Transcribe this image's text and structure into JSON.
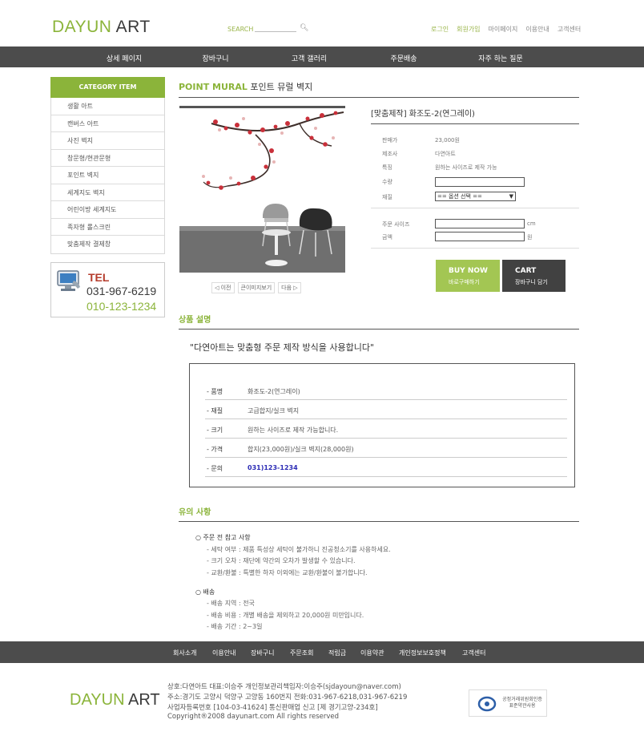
{
  "header": {
    "logo_a": "DAYUN",
    "logo_b": " ART",
    "search_label": "SEARCH",
    "top_links": [
      "로그인",
      "회원가입",
      "마이페이지",
      "이용안내",
      "고객센터"
    ]
  },
  "nav": [
    "상세 페이지",
    "장바구니",
    "고객 갤러리",
    "주문배송",
    "자주 하는 질문"
  ],
  "sidebar": {
    "category_title": "CATEGORY ITEM",
    "items": [
      "생활 아트",
      "캔버스 아트",
      "사진 벽지",
      "창문형/현관문형",
      "포인트 벽지",
      "세계지도 벽지",
      "어린이방 세계지도",
      "족자형 롤스크린",
      "맞춤제작 결제창"
    ],
    "tel_label": "TEL",
    "tel_1": "031-967-6219",
    "tel_2": "010-123-1234"
  },
  "product": {
    "section_en": "POINT MURAL",
    "section_ko": " 포인트 뮤럴 벽지",
    "name": "[맞춤제작] 화조도-2(연그레이)",
    "rows": {
      "price_label": "판매가",
      "price": "23,000원",
      "maker_label": "제조사",
      "maker": "다연아트",
      "feature_label": "특징",
      "feature": "원하는 사이즈로 제작 가능",
      "qty_label": "수량",
      "material_label": "재질",
      "material_select": "== 옵션 선택 ==",
      "size_label": "주문 사이즈",
      "size_unit": "cm",
      "amount_label": "금액",
      "amount_unit": "원"
    },
    "image_nav": {
      "prev": "◁ 이전",
      "zoom": "큰이미지보기",
      "next": "다음 ▷"
    },
    "buy_button": {
      "title": "BUY NOW",
      "sub": "바로구매하기"
    },
    "cart_button": {
      "title": "CART",
      "sub": "장바구니 담기"
    }
  },
  "description": {
    "title": "상품 설명",
    "quote": "\"다연아트는 맞춤형 주문 제작 방식을 사용합니다\"",
    "specs": [
      {
        "k": "- 품명",
        "v": "화조도-2(연그레이)"
      },
      {
        "k": "- 재질",
        "v": "고급합지/실크 벽지"
      },
      {
        "k": "- 크기",
        "v": "원하는 사이즈로 제작 가능합니다."
      },
      {
        "k": "- 가격",
        "v": "합지(23,000원)/실크 벽지(28,000원)"
      },
      {
        "k": "- 문의",
        "v": "031)123-1234"
      }
    ]
  },
  "notice": {
    "title": "유의 사항",
    "group1_title": "○ 주문 전 참고 사항",
    "group1": [
      "- 세탁 여부 : 제품 특성상 세탁이 불가하니 진공청소기를 사용하세요.",
      "- 크기 오차 : 재단에 약간의 오차가 발생할 수 있습니다.",
      "- 교환/환불 : 특별한 하자 이외에는 교환/환불이 불가합니다."
    ],
    "group2_title": "○ 배송",
    "group2": [
      "- 배송 지역 : 전국",
      "- 배송 비용 : 개별 배송을 제외하고 20,000원 미만입니다.",
      "- 배송 기간 : 2~3일"
    ]
  },
  "footer": {
    "links": [
      "회사소개",
      "이용안내",
      "장바구니",
      "주문조회",
      "적립금",
      "이용약관",
      "개인정보보호정책",
      "고객센터"
    ],
    "logo_a": "DAYUN",
    "logo_b": " ART",
    "info": [
      "상호:다연아트  대표:이승주  개인정보관리책임자:이승주(sjdayoun@naver.com)",
      "주소:경기도 고양시 덕양구 고양동 160번지 전화:031-967-6218,031-967-6219",
      "사업자등록번호 [104-03-41624] 통신판매업 신고 [제 경기고양-234호]",
      "Copyright®2008 dayunart.com All rights reserved"
    ],
    "badge": "공정거래위원회인증\n표준약관사용"
  }
}
